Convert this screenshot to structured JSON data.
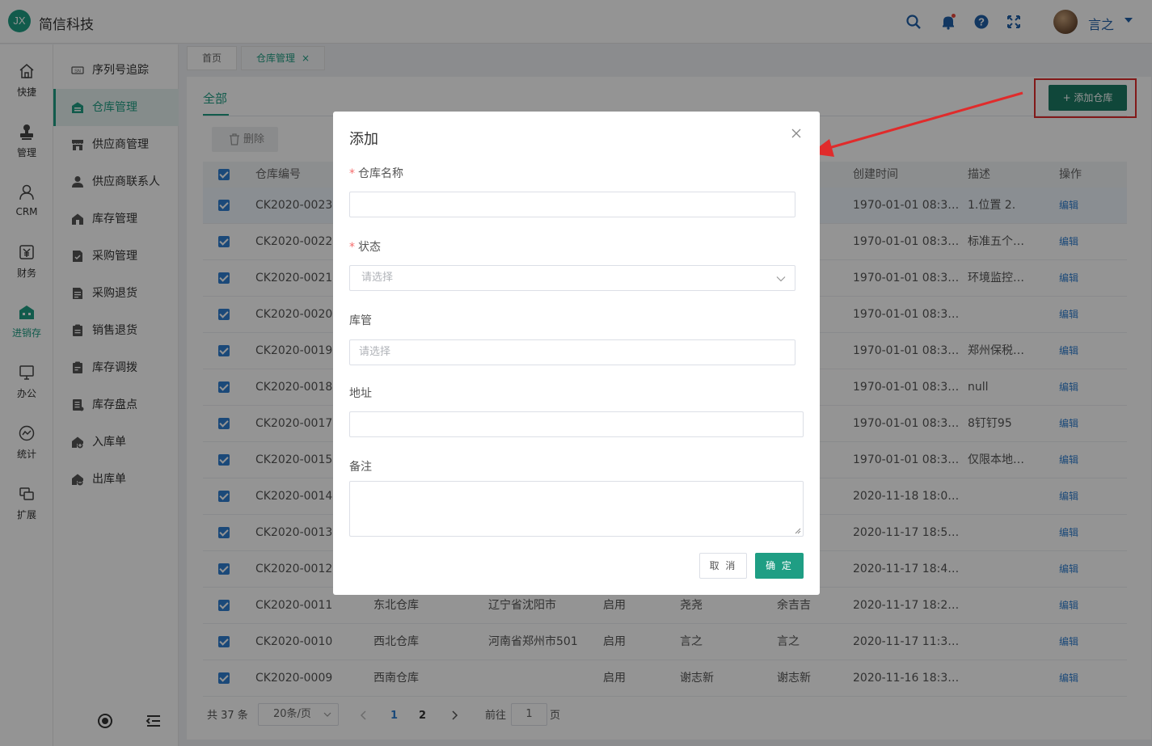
{
  "app": {
    "logo_text": "JX",
    "brand": "简信科技",
    "user_name": "言之"
  },
  "header_icons": [
    "search-icon",
    "bell-icon",
    "help-icon",
    "fullscreen-icon"
  ],
  "rail": [
    {
      "label": "快捷",
      "icon": "home-icon"
    },
    {
      "label": "管理",
      "icon": "stamp-icon"
    },
    {
      "label": "CRM",
      "icon": "person-icon"
    },
    {
      "label": "财务",
      "icon": "yen-icon"
    },
    {
      "label": "进销存",
      "icon": "warehouse-icon",
      "active": true
    },
    {
      "label": "办公",
      "icon": "monitor-icon"
    },
    {
      "label": "统计",
      "icon": "chart-icon"
    },
    {
      "label": "扩展",
      "icon": "extend-icon"
    }
  ],
  "menu": [
    {
      "label": "序列号追踪",
      "icon": "sn-icon"
    },
    {
      "label": "仓库管理",
      "icon": "warehouse-icon",
      "active": true
    },
    {
      "label": "供应商管理",
      "icon": "store-icon"
    },
    {
      "label": "供应商联系人",
      "icon": "contact-icon"
    },
    {
      "label": "库存管理",
      "icon": "house-icon"
    },
    {
      "label": "采购管理",
      "icon": "doc-icon"
    },
    {
      "label": "采购退货",
      "icon": "doc-return-icon"
    },
    {
      "label": "销售退货",
      "icon": "clipboard-icon"
    },
    {
      "label": "库存调拨",
      "icon": "clipboard-transfer-icon"
    },
    {
      "label": "库存盘点",
      "icon": "list-icon"
    },
    {
      "label": "入库单",
      "icon": "inbound-icon"
    },
    {
      "label": "出库单",
      "icon": "outbound-icon"
    }
  ],
  "tabs": [
    {
      "label": "首页"
    },
    {
      "label": "仓库管理",
      "active": true,
      "close": "×"
    }
  ],
  "page": {
    "subtab": "全部",
    "add_button": "+ 添加仓库",
    "delete_button": "删除"
  },
  "table": {
    "columns": [
      "仓库编号",
      "创建时间",
      "描述",
      "操作"
    ],
    "rows": [
      {
        "code": "CK2020-0023",
        "name": "",
        "addr": "",
        "status": "",
        "keeper": "",
        "creator": "",
        "created": "1970-01-01 08:3…",
        "desc": "1.位置 2.",
        "op": "编辑"
      },
      {
        "code": "CK2020-0022",
        "name": "",
        "addr": "",
        "status": "",
        "keeper": "",
        "creator": "",
        "created": "1970-01-01 08:3…",
        "desc": "标准五个…",
        "op": "编辑"
      },
      {
        "code": "CK2020-0021",
        "name": "",
        "addr": "",
        "status": "",
        "keeper": "",
        "creator": "",
        "created": "1970-01-01 08:3…",
        "desc": "环境监控…",
        "op": "编辑"
      },
      {
        "code": "CK2020-0020",
        "name": "",
        "addr": "",
        "status": "",
        "keeper": "",
        "creator": "",
        "created": "1970-01-01 08:3…",
        "desc": "",
        "op": "编辑"
      },
      {
        "code": "CK2020-0019",
        "name": "",
        "addr": "",
        "status": "",
        "keeper": "",
        "creator": "",
        "created": "1970-01-01 08:3…",
        "desc": "郑州保税…",
        "op": "编辑"
      },
      {
        "code": "CK2020-0018",
        "name": "",
        "addr": "",
        "status": "",
        "keeper": "",
        "creator": "",
        "created": "1970-01-01 08:3…",
        "desc": "null",
        "op": "编辑"
      },
      {
        "code": "CK2020-0017",
        "name": "",
        "addr": "",
        "status": "",
        "keeper": "",
        "creator": "",
        "created": "1970-01-01 08:3…",
        "desc": "8钉钉95",
        "op": "编辑"
      },
      {
        "code": "CK2020-0015",
        "name": "",
        "addr": "",
        "status": "",
        "keeper": "",
        "creator": "",
        "created": "1970-01-01 08:3…",
        "desc": "仅限本地…",
        "op": "编辑"
      },
      {
        "code": "CK2020-0014",
        "name": "",
        "addr": "",
        "status": "",
        "keeper": "",
        "creator": "",
        "created": "2020-11-18 18:0…",
        "desc": "",
        "op": "编辑"
      },
      {
        "code": "CK2020-0013",
        "name": "",
        "addr": "",
        "status": "",
        "keeper": "",
        "creator": "",
        "created": "2020-11-17 18:5…",
        "desc": "",
        "op": "编辑"
      },
      {
        "code": "CK2020-0012",
        "name": "",
        "addr": "",
        "status": "",
        "keeper": "",
        "creator": "",
        "created": "2020-11-17 18:4…",
        "desc": "",
        "op": "编辑"
      },
      {
        "code": "CK2020-0011",
        "name": "东北仓库",
        "addr": "辽宁省沈阳市",
        "status": "启用",
        "keeper": "尧尧",
        "creator": "余吉吉",
        "created": "2020-11-17 18:2…",
        "desc": "",
        "op": "编辑"
      },
      {
        "code": "CK2020-0010",
        "name": "西北仓库",
        "addr": "河南省郑州市501",
        "status": "启用",
        "keeper": "言之",
        "creator": "言之",
        "created": "2020-11-17 11:3…",
        "desc": "",
        "op": "编辑"
      },
      {
        "code": "CK2020-0009",
        "name": "西南仓库",
        "addr": "",
        "status": "启用",
        "keeper": "谢志新",
        "creator": "谢志新",
        "created": "2020-11-16 18:3…",
        "desc": "",
        "op": "编辑"
      }
    ]
  },
  "pager": {
    "total": "共 37 条",
    "page_size": "20条/页",
    "pages": [
      "1",
      "2"
    ],
    "current": "1",
    "goto_prefix": "前往",
    "goto_value": "1",
    "goto_suffix": "页"
  },
  "modal": {
    "title": "添加",
    "fields": {
      "name": {
        "label": "仓库名称",
        "required": "*",
        "value": ""
      },
      "status": {
        "label": "状态",
        "required": "*",
        "placeholder": "请选择"
      },
      "keeper": {
        "label": "库管",
        "placeholder": "请选择"
      },
      "address": {
        "label": "地址",
        "value": ""
      },
      "remark": {
        "label": "备注",
        "value": ""
      }
    },
    "cancel": "取 消",
    "confirm": "确 定"
  },
  "colors": {
    "accent": "#1f9e84",
    "button": "#1d7a64",
    "link": "#2f7fd0",
    "highlight": "#e02b2b"
  }
}
